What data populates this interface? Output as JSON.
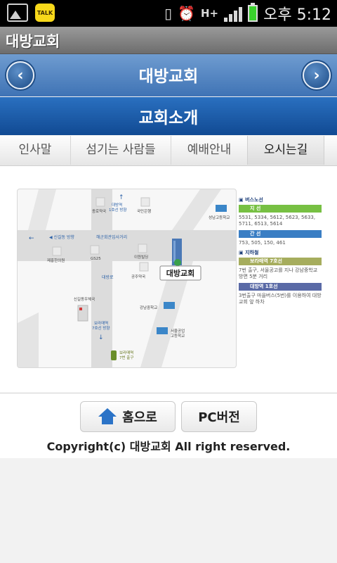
{
  "status_bar": {
    "clock": "오후 5:12",
    "left_icons": [
      "gallery-icon",
      "kakaotalk-icon"
    ],
    "kakao_label": "TALK",
    "network_label": "H+",
    "right_icons": [
      "vibrate-icon",
      "alarm-icon",
      "network-h-plus-icon",
      "signal-icon",
      "battery-icon"
    ],
    "battery_color": "#39d12c"
  },
  "app": {
    "title": "대방교회"
  },
  "nav": {
    "title": "대방교회",
    "prev_label": "‹",
    "next_label": "›"
  },
  "section": {
    "title": "교회소개"
  },
  "tabs": [
    {
      "label": "인사말",
      "active": false
    },
    {
      "label": "섬기는 사람들",
      "active": false
    },
    {
      "label": "예배안내",
      "active": false
    },
    {
      "label": "오시는길",
      "active": true
    }
  ],
  "map": {
    "church_label": "대방교회",
    "labels": [
      "종로약국",
      "국민은행",
      "대방역\n1호선 방향",
      "성남고등학교",
      "신길동 방향",
      "해군회관입사거리",
      "제홍한의원",
      "GS25",
      "이원빌딩",
      "대방로",
      "공주약국",
      "신길동우체국",
      "강남중학교",
      "보라매역\n7호선 방향",
      "서울공업\n고등학교",
      "보라매역\n7번 출구"
    ]
  },
  "legend": {
    "bus_heading": "버스노선",
    "bus_blue_label": "지 선",
    "bus_blue_lines": "5531, 5334, 5612, 5623, 5633, 5711, 6513, 5614",
    "bus_trunk_label": "간 선",
    "bus_trunk_lines": "753, 505, 150, 461",
    "subway_heading": "지하철",
    "line7_label": "보라매역 7호선",
    "line7_text": "7번 출구, 서울공고를 지나 강남중학교 방면 5분 거리",
    "line1_label": "대방역 1호선",
    "line1_text": "3번출구 마을버스(5번)를 이용하여 대방교회 앞 하차",
    "colors": {
      "green": "#77c043",
      "blue": "#3a7ec4",
      "olive": "#a6ad5d",
      "navy": "#5a6aa6"
    }
  },
  "footer": {
    "home_button": "홈으로",
    "pc_button": "PC버전",
    "copyright": "Copyright(c) 대방교회 All right reserved."
  }
}
